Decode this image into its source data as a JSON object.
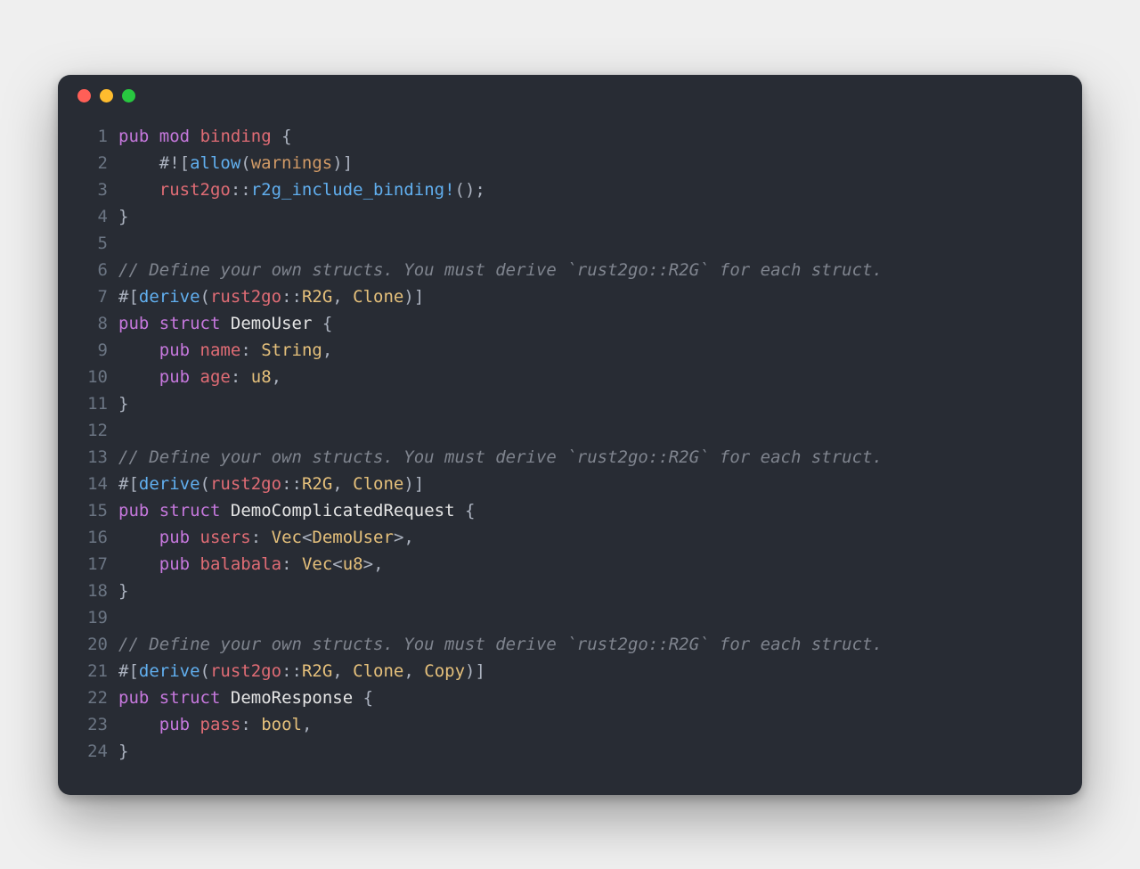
{
  "window": {
    "buttons": [
      "close",
      "minimize",
      "zoom"
    ]
  },
  "code": {
    "language": "rust",
    "lines": [
      {
        "n": 1,
        "tokens": [
          {
            "c": "kw",
            "t": "pub"
          },
          {
            "c": "pn",
            "t": " "
          },
          {
            "c": "kw",
            "t": "mod"
          },
          {
            "c": "pn",
            "t": " "
          },
          {
            "c": "id",
            "t": "binding"
          },
          {
            "c": "pn",
            "t": " {"
          }
        ]
      },
      {
        "n": 2,
        "tokens": [
          {
            "c": "pn",
            "t": "    #!["
          },
          {
            "c": "fn",
            "t": "allow"
          },
          {
            "c": "pn",
            "t": "("
          },
          {
            "c": "wn",
            "t": "warnings"
          },
          {
            "c": "pn",
            "t": ")]"
          }
        ]
      },
      {
        "n": 3,
        "tokens": [
          {
            "c": "pn",
            "t": "    "
          },
          {
            "c": "id",
            "t": "rust2go"
          },
          {
            "c": "pn",
            "t": "::"
          },
          {
            "c": "fn",
            "t": "r2g_include_binding!"
          },
          {
            "c": "pn",
            "t": "();"
          }
        ]
      },
      {
        "n": 4,
        "tokens": [
          {
            "c": "pn",
            "t": "}"
          }
        ]
      },
      {
        "n": 5,
        "tokens": []
      },
      {
        "n": 6,
        "tokens": [
          {
            "c": "cm",
            "t": "// Define your own structs. You must derive `rust2go::R2G` for each struct."
          }
        ]
      },
      {
        "n": 7,
        "tokens": [
          {
            "c": "pn",
            "t": "#["
          },
          {
            "c": "fn",
            "t": "derive"
          },
          {
            "c": "pn",
            "t": "("
          },
          {
            "c": "id",
            "t": "rust2go"
          },
          {
            "c": "pn",
            "t": "::"
          },
          {
            "c": "ty",
            "t": "R2G"
          },
          {
            "c": "pn",
            "t": ", "
          },
          {
            "c": "ty",
            "t": "Clone"
          },
          {
            "c": "pn",
            "t": ")]"
          }
        ]
      },
      {
        "n": 8,
        "tokens": [
          {
            "c": "kw",
            "t": "pub"
          },
          {
            "c": "pn",
            "t": " "
          },
          {
            "c": "kw",
            "t": "struct"
          },
          {
            "c": "pn",
            "t": " "
          },
          {
            "c": "wht",
            "t": "DemoUser"
          },
          {
            "c": "pn",
            "t": " {"
          }
        ]
      },
      {
        "n": 9,
        "tokens": [
          {
            "c": "pn",
            "t": "    "
          },
          {
            "c": "kw",
            "t": "pub"
          },
          {
            "c": "pn",
            "t": " "
          },
          {
            "c": "id",
            "t": "name"
          },
          {
            "c": "pn",
            "t": ": "
          },
          {
            "c": "ty",
            "t": "String"
          },
          {
            "c": "pn",
            "t": ","
          }
        ]
      },
      {
        "n": 10,
        "tokens": [
          {
            "c": "pn",
            "t": "    "
          },
          {
            "c": "kw",
            "t": "pub"
          },
          {
            "c": "pn",
            "t": " "
          },
          {
            "c": "id",
            "t": "age"
          },
          {
            "c": "pn",
            "t": ": "
          },
          {
            "c": "ty",
            "t": "u8"
          },
          {
            "c": "pn",
            "t": ","
          }
        ]
      },
      {
        "n": 11,
        "tokens": [
          {
            "c": "pn",
            "t": "}"
          }
        ]
      },
      {
        "n": 12,
        "tokens": []
      },
      {
        "n": 13,
        "tokens": [
          {
            "c": "cm",
            "t": "// Define your own structs. You must derive `rust2go::R2G` for each struct."
          }
        ]
      },
      {
        "n": 14,
        "tokens": [
          {
            "c": "pn",
            "t": "#["
          },
          {
            "c": "fn",
            "t": "derive"
          },
          {
            "c": "pn",
            "t": "("
          },
          {
            "c": "id",
            "t": "rust2go"
          },
          {
            "c": "pn",
            "t": "::"
          },
          {
            "c": "ty",
            "t": "R2G"
          },
          {
            "c": "pn",
            "t": ", "
          },
          {
            "c": "ty",
            "t": "Clone"
          },
          {
            "c": "pn",
            "t": ")]"
          }
        ]
      },
      {
        "n": 15,
        "tokens": [
          {
            "c": "kw",
            "t": "pub"
          },
          {
            "c": "pn",
            "t": " "
          },
          {
            "c": "kw",
            "t": "struct"
          },
          {
            "c": "pn",
            "t": " "
          },
          {
            "c": "wht",
            "t": "DemoComplicatedRequest"
          },
          {
            "c": "pn",
            "t": " {"
          }
        ]
      },
      {
        "n": 16,
        "tokens": [
          {
            "c": "pn",
            "t": "    "
          },
          {
            "c": "kw",
            "t": "pub"
          },
          {
            "c": "pn",
            "t": " "
          },
          {
            "c": "id",
            "t": "users"
          },
          {
            "c": "pn",
            "t": ": "
          },
          {
            "c": "ty",
            "t": "Vec"
          },
          {
            "c": "pn",
            "t": "<"
          },
          {
            "c": "ty",
            "t": "DemoUser"
          },
          {
            "c": "pn",
            "t": ">,"
          }
        ]
      },
      {
        "n": 17,
        "tokens": [
          {
            "c": "pn",
            "t": "    "
          },
          {
            "c": "kw",
            "t": "pub"
          },
          {
            "c": "pn",
            "t": " "
          },
          {
            "c": "id",
            "t": "balabala"
          },
          {
            "c": "pn",
            "t": ": "
          },
          {
            "c": "ty",
            "t": "Vec"
          },
          {
            "c": "pn",
            "t": "<"
          },
          {
            "c": "ty",
            "t": "u8"
          },
          {
            "c": "pn",
            "t": ">,"
          }
        ]
      },
      {
        "n": 18,
        "tokens": [
          {
            "c": "pn",
            "t": "}"
          }
        ]
      },
      {
        "n": 19,
        "tokens": []
      },
      {
        "n": 20,
        "tokens": [
          {
            "c": "cm",
            "t": "// Define your own structs. You must derive `rust2go::R2G` for each struct."
          }
        ]
      },
      {
        "n": 21,
        "tokens": [
          {
            "c": "pn",
            "t": "#["
          },
          {
            "c": "fn",
            "t": "derive"
          },
          {
            "c": "pn",
            "t": "("
          },
          {
            "c": "id",
            "t": "rust2go"
          },
          {
            "c": "pn",
            "t": "::"
          },
          {
            "c": "ty",
            "t": "R2G"
          },
          {
            "c": "pn",
            "t": ", "
          },
          {
            "c": "ty",
            "t": "Clone"
          },
          {
            "c": "pn",
            "t": ", "
          },
          {
            "c": "ty",
            "t": "Copy"
          },
          {
            "c": "pn",
            "t": ")]"
          }
        ]
      },
      {
        "n": 22,
        "tokens": [
          {
            "c": "kw",
            "t": "pub"
          },
          {
            "c": "pn",
            "t": " "
          },
          {
            "c": "kw",
            "t": "struct"
          },
          {
            "c": "pn",
            "t": " "
          },
          {
            "c": "wht",
            "t": "DemoResponse"
          },
          {
            "c": "pn",
            "t": " {"
          }
        ]
      },
      {
        "n": 23,
        "tokens": [
          {
            "c": "pn",
            "t": "    "
          },
          {
            "c": "kw",
            "t": "pub"
          },
          {
            "c": "pn",
            "t": " "
          },
          {
            "c": "id",
            "t": "pass"
          },
          {
            "c": "pn",
            "t": ": "
          },
          {
            "c": "ty",
            "t": "bool"
          },
          {
            "c": "pn",
            "t": ","
          }
        ]
      },
      {
        "n": 24,
        "tokens": [
          {
            "c": "pn",
            "t": "}"
          }
        ]
      }
    ]
  }
}
